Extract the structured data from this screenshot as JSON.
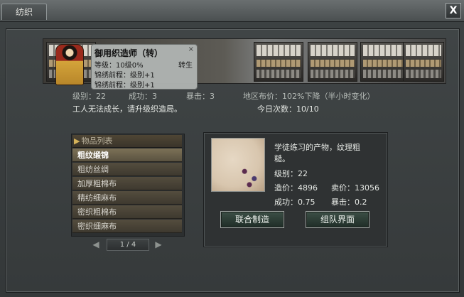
{
  "window": {
    "tab_label": "纺织",
    "close_label": "X"
  },
  "tooltip": {
    "title": "御用织造师（转）",
    "close": "×",
    "level_line": "等级：10级0%",
    "rebirth": "转生",
    "req1": "锦绣前程：级别+1",
    "req2": "锦绣前程：级别+1"
  },
  "stats": {
    "level": "级别：22",
    "success": "成功：3",
    "crit": "暴击：3",
    "region_price": "地区布价：102%下降（半小时变化）",
    "cannot_grow": "工人无法成长，请升级织造局。",
    "daily_count": "今日次数：10/10"
  },
  "item_list": {
    "header": "物品列表",
    "header_icon": "triangle-right-icon",
    "items": [
      "粗纹缎锦",
      "粗纺丝绸",
      "加厚粗棉布",
      "精纺细麻布",
      "密织粗棉布",
      "密织细麻布"
    ],
    "selected_index": 0,
    "page": "1 / 4",
    "prev_icon": "arrow-left-icon",
    "next_icon": "arrow-right-icon"
  },
  "detail": {
    "desc_line1": "学徒练习的产物，纹理粗",
    "desc_line2": "糙。",
    "level": "级别：22",
    "cost": "造价：4896",
    "sell": "卖价：13056",
    "success": "成功：0.75",
    "crit": "暴击：0.2",
    "btn_joint": "联合制造",
    "btn_team": "组队界面"
  },
  "colors": {
    "panel_bg": "#363a3b",
    "button_bg": "#2b3a33",
    "list_selected": "#6b624c"
  }
}
